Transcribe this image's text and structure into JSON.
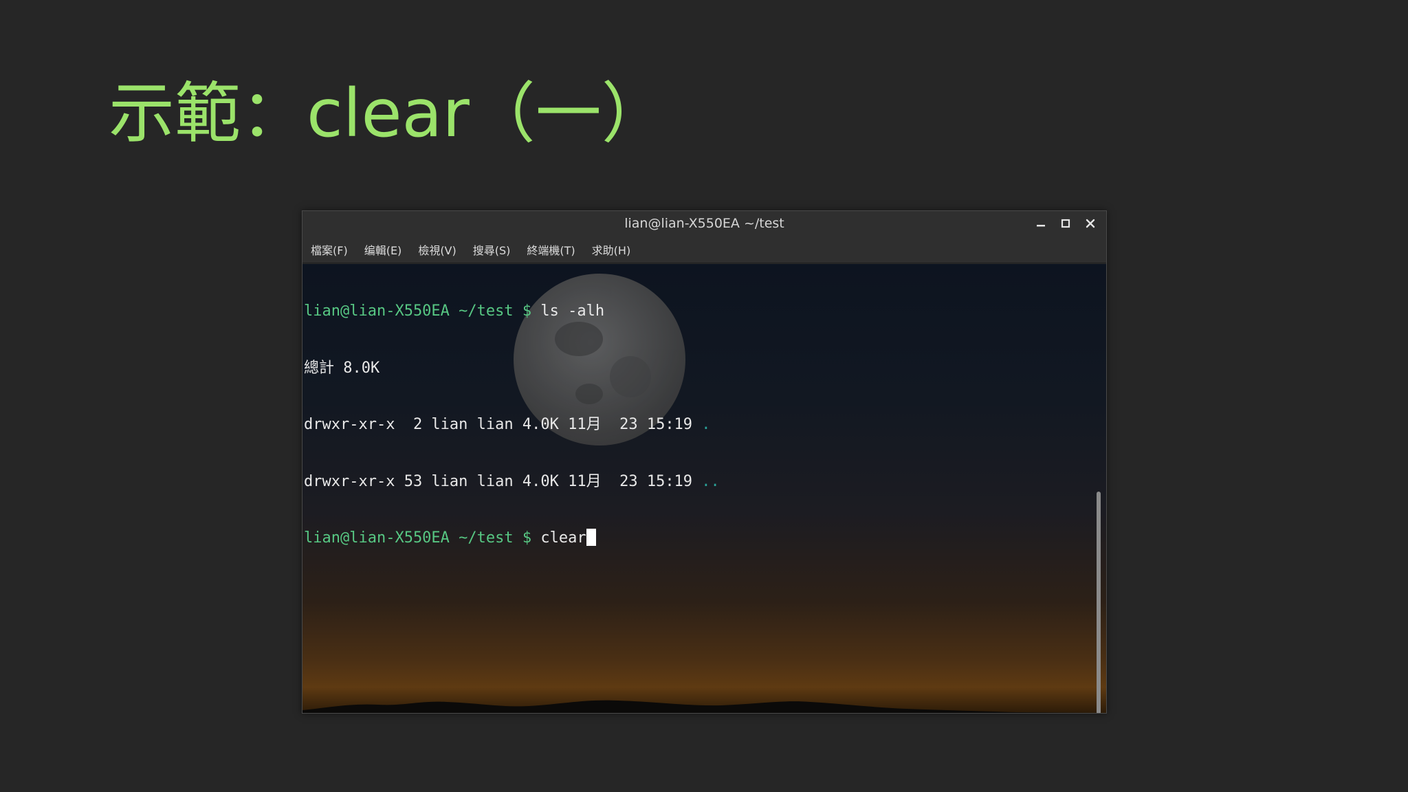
{
  "slide": {
    "title": "示範：clear（一）"
  },
  "window": {
    "title": "lian@lian-X550EA ~/test",
    "controls": {
      "minimize_icon": "minimize-icon",
      "maximize_icon": "maximize-icon",
      "close_icon": "close-icon"
    }
  },
  "menu": {
    "items": [
      {
        "label": "檔案(F)"
      },
      {
        "label": "编輯(E)"
      },
      {
        "label": "檢視(V)"
      },
      {
        "label": "搜尋(S)"
      },
      {
        "label": "終端機(T)"
      },
      {
        "label": "求助(H)"
      }
    ]
  },
  "terminal": {
    "prompt": "lian@lian-X550EA ~/test $",
    "line1_cmd": " ls -alh",
    "line2": "總計 8.0K",
    "line3_text": "drwxr-xr-x  2 lian lian 4.0K 11月  23 15:19 ",
    "line3_name": ".",
    "line4_text": "drwxr-xr-x 53 lian lian 4.0K 11月  23 15:19 ",
    "line4_name": "..",
    "line5_cmd": " clear"
  },
  "colors": {
    "title_green": "#9be36a",
    "prompt_green": "#57c783",
    "dir_cyan": "#2aa198",
    "slide_bg": "#262626"
  }
}
